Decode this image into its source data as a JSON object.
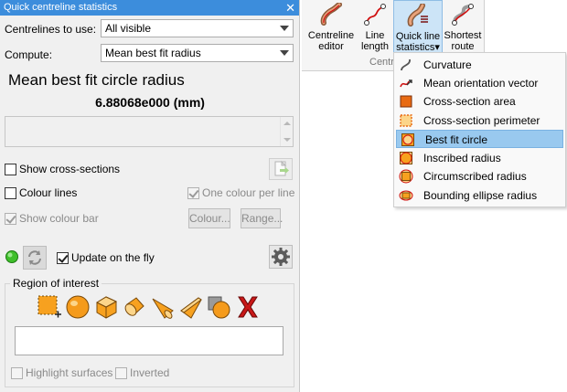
{
  "panel": {
    "title": "Quick centreline statistics",
    "close_glyph": "✕",
    "centrelines_label": "Centrelines to use:",
    "centrelines_value": "All visible",
    "compute_label": "Compute:",
    "compute_value": "Mean best fit radius",
    "result_title": "Mean best fit circle radius",
    "result_value": "6.88068e000 (mm)",
    "show_cross_sections": "Show cross-sections",
    "colour_lines": "Colour lines",
    "one_colour_per_line": "One colour per line",
    "show_colour_bar": "Show colour bar",
    "colour_button": "Colour...",
    "range_button": "Range...",
    "update_on_the_fly": "Update on the fly",
    "region_of_interest": "Region of interest",
    "highlight_surfaces": "Highlight surfaces",
    "inverted": "Inverted",
    "roi_tools": [
      "add-roi-icon",
      "sphere-roi-icon",
      "cube-roi-icon",
      "cylinder-roi-icon",
      "cone-roi-icon",
      "slab-roi-icon",
      "surface-roi-icon",
      "delete-roi-icon"
    ],
    "colors": {
      "title_bar": "#3c8ddc",
      "status_ok": "#3fbf2b",
      "delete": "#c81818",
      "roi_orange": "#f7a11f"
    }
  },
  "ribbon": {
    "buttons": [
      {
        "label_line1": "Centreline",
        "label_line2": "editor",
        "icon": "centreline-editor-icon"
      },
      {
        "label_line1": "Line",
        "label_line2": "length",
        "icon": "line-length-icon"
      },
      {
        "label_line1": "Quick line",
        "label_line2": "statistics▾",
        "icon": "quick-line-statistics-icon"
      },
      {
        "label_line1": "Shortest",
        "label_line2": "route",
        "icon": "shortest-route-icon"
      }
    ],
    "group_label": "Centr"
  },
  "menu": {
    "items": [
      {
        "label": "Curvature",
        "icon": "curvature-icon"
      },
      {
        "label": "Mean orientation vector",
        "icon": "orientation-vector-icon"
      },
      {
        "label": "Cross-section area",
        "icon": "cross-section-area-icon"
      },
      {
        "label": "Cross-section perimeter",
        "icon": "cross-section-perimeter-icon"
      },
      {
        "label": "Best fit circle",
        "icon": "best-fit-circle-icon"
      },
      {
        "label": "Inscribed radius",
        "icon": "inscribed-radius-icon"
      },
      {
        "label": "Circumscribed radius",
        "icon": "circumscribed-radius-icon"
      },
      {
        "label": "Bounding ellipse radius",
        "icon": "bounding-ellipse-icon"
      }
    ],
    "active_label": "Best fit circle"
  }
}
